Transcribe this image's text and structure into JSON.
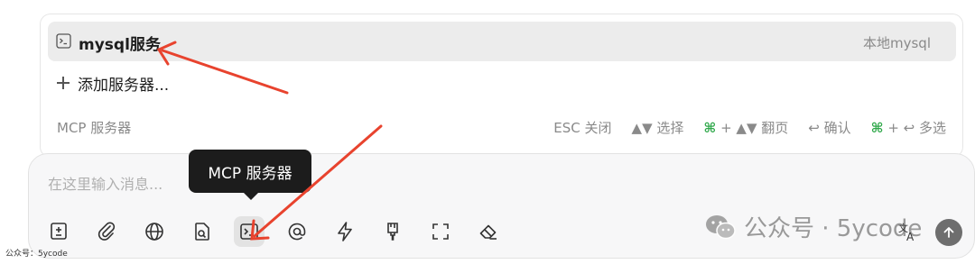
{
  "mcp_popover": {
    "server_item": {
      "icon": "terminal-icon",
      "name": "mysql服务",
      "tag": "本地mysql"
    },
    "add_server_label": "添加服务器...",
    "footer_title": "MCP 服务器",
    "hints": [
      {
        "key": "ESC",
        "text": " 关闭"
      },
      {
        "key": "▲▼",
        "text": " 选择"
      },
      {
        "key": "⌘",
        "text": " + ▲▼ 翻页"
      },
      {
        "key": "↩",
        "text": " 确认"
      },
      {
        "key": "⌘",
        "text": " + ↩ 多选"
      }
    ]
  },
  "composer": {
    "placeholder": "在这里输入消息...",
    "tooltip": "MCP 服务器",
    "toolbar": [
      "new-chat-icon",
      "paperclip-icon",
      "globe-icon",
      "document-search-icon",
      "terminal-icon",
      "at-sign-icon",
      "lightning-icon",
      "brush-icon",
      "fullscreen-icon",
      "eraser-icon"
    ],
    "active_tool": "terminal-icon",
    "translate_icon": "translate-icon",
    "send_icon": "arrow-up-icon"
  },
  "watermark": {
    "text": "公众号 · 5ycode"
  },
  "corner_credit": "公众号：5ycode",
  "colors": {
    "accent_green": "#2fa84a",
    "annotation_arrow": "#e8432e",
    "tooltip_bg": "#1c1c1c"
  }
}
